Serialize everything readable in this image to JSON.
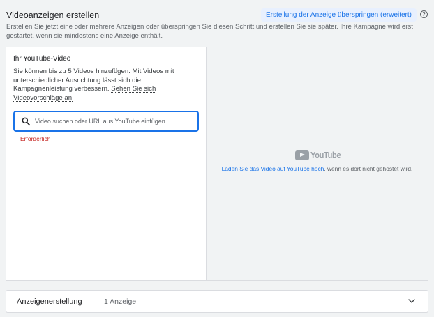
{
  "header": {
    "title": "Videoanzeigen erstellen",
    "skip_button": "Erstellung der Anzeige überspringen (erweitert)",
    "help_icon": "?",
    "description": "Erstellen Sie jetzt eine oder mehrere Anzeigen oder überspringen Sie diesen Schritt und erstellen Sie sie später. Ihre Kampagne wird erst gestartet, wenn sie mindestens eine Anzeige enthält."
  },
  "video_panel": {
    "title": "Ihr YouTube-Video",
    "text": "Sie können bis zu 5 Videos hinzufügen. Mit Videos mit unterschiedlicher Ausrichtung lässt sich die Kampagnenleistung verbessern.",
    "suggestions_link": "Sehen Sie sich Videovorschläge an.",
    "search_placeholder": "Video suchen oder URL aus YouTube einfügen",
    "search_value": "",
    "required_text": "Erforderlich"
  },
  "preview": {
    "logo_text": "YouTube",
    "upload_link": "Laden Sie das Video auf YouTube hoch",
    "upload_suffix": ", wenn es dort nicht gehostet wird."
  },
  "footer": {
    "label": "Anzeigenerstellung",
    "count": "1 Anzeige"
  },
  "icons": {
    "search": "search-icon",
    "help": "help-icon",
    "expand": "chevron-down-icon",
    "youtube": "youtube-logo"
  },
  "colors": {
    "accent": "#1a73e8",
    "error": "#c5221f",
    "skip_bg": "#e8f0fe"
  }
}
